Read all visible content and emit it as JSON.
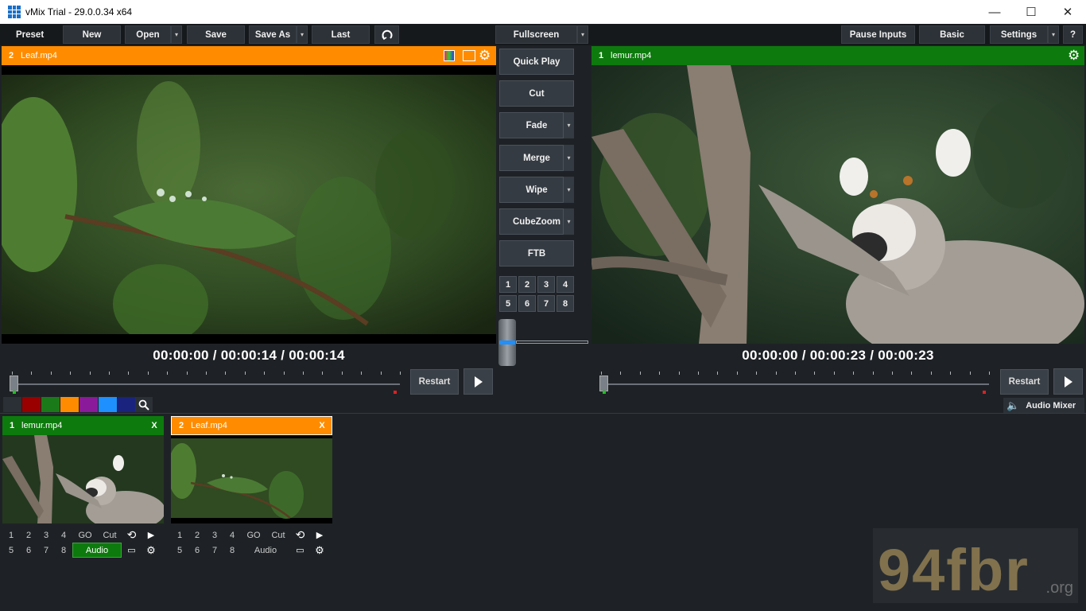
{
  "window": {
    "title": "vMix Trial - 29.0.0.34 x64",
    "minimize": "—",
    "maximize": "☐",
    "close": "✕"
  },
  "menubar": {
    "preset": "Preset",
    "new": "New",
    "open": "Open",
    "save": "Save",
    "save_as": "Save As",
    "last": "Last",
    "fullscreen": "Fullscreen",
    "pause_inputs": "Pause Inputs",
    "basic": "Basic",
    "settings": "Settings",
    "help": "?"
  },
  "preview": {
    "number": "2",
    "name": "Leaf.mp4",
    "timecode": "00:00:00  /  00:00:14  /  00:00:14",
    "restart": "Restart"
  },
  "output": {
    "number": "1",
    "name": "lemur.mp4",
    "timecode": "00:00:00  /  00:00:23  /  00:00:23",
    "restart": "Restart"
  },
  "transitions": {
    "quick_play": "Quick Play",
    "cut": "Cut",
    "fade": "Fade",
    "merge": "Merge",
    "wipe": "Wipe",
    "cubezoom": "CubeZoom",
    "ftb": "FTB",
    "numbers": [
      "1",
      "2",
      "3",
      "4",
      "5",
      "6",
      "7",
      "8"
    ]
  },
  "audio_mixer": "Audio Mixer",
  "swatch_colors": [
    "#2b3036",
    "#9a0000",
    "#1a7a1a",
    "#ff8c00",
    "#8a1a9a",
    "#1e90ff",
    "#1a237e"
  ],
  "inputs": [
    {
      "number": "1",
      "name": "lemur.mp4",
      "close": "X",
      "color": "#0d7a0d",
      "row1": [
        "1",
        "2",
        "3",
        "4",
        "GO",
        "Cut"
      ],
      "row2": [
        "5",
        "6",
        "7",
        "8"
      ],
      "audio": "Audio",
      "audio_active": true
    },
    {
      "number": "2",
      "name": "Leaf.mp4",
      "close": "X",
      "color": "#ff8c00",
      "row1": [
        "1",
        "2",
        "3",
        "4",
        "GO",
        "Cut"
      ],
      "row2": [
        "5",
        "6",
        "7",
        "8"
      ],
      "audio": "Audio",
      "audio_active": false
    }
  ],
  "colors": {
    "preview": "#ff8c00",
    "output": "#0d7a0d",
    "accent": "#1e90ff"
  },
  "watermark": {
    "main": "94fbr",
    "tld": ".org"
  }
}
